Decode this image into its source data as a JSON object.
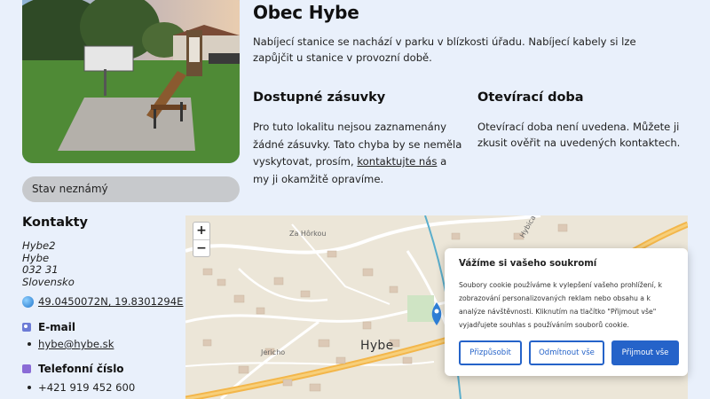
{
  "header": {
    "title": "Obec Hybe",
    "intro": "Nabíjecí stanice se nachází v parku v blízkosti úřadu. Nabíjecí kabely si lze zapůjčit u stanice v provozní době."
  },
  "status": {
    "label": "Stav neznámý"
  },
  "sockets": {
    "heading": "Dostupné zásuvky",
    "text_before": "Pro tuto lokalitu nejsou zaznamenány žádné zásuvky. Tato chyba by se neměla vyskytovat, prosím, ",
    "link": "kontaktujte nás",
    "text_after": " a my ji okamžitě opravíme."
  },
  "hours": {
    "heading": "Otevírací doba",
    "text": "Otevírací doba není uvedena. Můžete ji zkusit ověřit na uvedených kontaktech."
  },
  "contacts": {
    "heading": "Kontakty",
    "address": [
      "Hybe2",
      "Hybe",
      "032 31",
      "Slovensko"
    ],
    "coords": "49.0450072N, 19.8301294E",
    "email_heading": "E-mail",
    "email": "hybe@hybe.sk",
    "phone_heading": "Telefonní číslo",
    "phone": "+421 919 452 600"
  },
  "map": {
    "zoom_in": "+",
    "zoom_out": "−",
    "labels": {
      "street1": "Za Hôrkou",
      "street2": "Jericho",
      "street3": "Hybica",
      "village": "Hybe"
    }
  },
  "cookie": {
    "title": "Vážíme si vašeho soukromí",
    "text": "Soubory cookie používáme k vylepšení vašeho prohlížení, k zobrazování personalizovaných reklam nebo obsahu a k analýze návštěvnosti. Kliknutím na tlačítko \"Přijmout vše\" vyjadřujete souhlas s používáním souborů cookie.",
    "customize": "Přizpůsobit",
    "reject": "Odmítnout vše",
    "accept": "Přijmout vše"
  },
  "colors": {
    "accent": "#2563c9",
    "background": "#e9f0fb",
    "pin": "#2f7fd6"
  }
}
